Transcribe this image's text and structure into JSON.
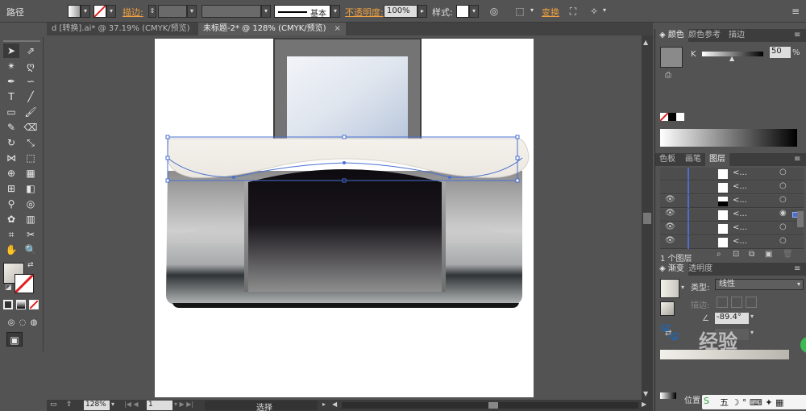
{
  "controlbar": {
    "object_type": "路径",
    "stroke_label": "描边:",
    "stroke_style": "基本",
    "opacity_label": "不透明度:",
    "opacity_value": "100%",
    "style_label": "样式:",
    "transform_label": "变换"
  },
  "tabs": [
    {
      "label": "d [转换].ai* @ 37.19% (CMYK/预览)",
      "close": "×"
    },
    {
      "label": "未标题-2* @ 128% (CMYK/预览)",
      "close": "×"
    }
  ],
  "statusbar": {
    "zoom": "128%",
    "page": "1",
    "tool_status": "选择"
  },
  "color_panel": {
    "tabs": [
      "颜色",
      "颜色参考",
      "描边"
    ],
    "channel_label": "K",
    "channel_value": "50",
    "percent": "%"
  },
  "layers_panel": {
    "tabs": [
      "色板",
      "画笔",
      "图层"
    ],
    "layer_names": [
      "<...",
      "<...",
      "<...",
      "<...",
      "<...",
      "<..."
    ],
    "footer": "1 个图层"
  },
  "gradient_panel": {
    "tabs": [
      "渐变",
      "透明度"
    ],
    "type_label": "类型:",
    "type_value": "线性",
    "stroke_label": "描边:",
    "angle_value": "-89.4°",
    "location_label": "位置"
  },
  "watermark": {
    "text": "经验"
  },
  "colors": {
    "ui_bg": "#535353",
    "panel_dark": "#3d3d3d",
    "accent_orange": "#f0a040",
    "selection_blue": "#4a6fd0"
  }
}
